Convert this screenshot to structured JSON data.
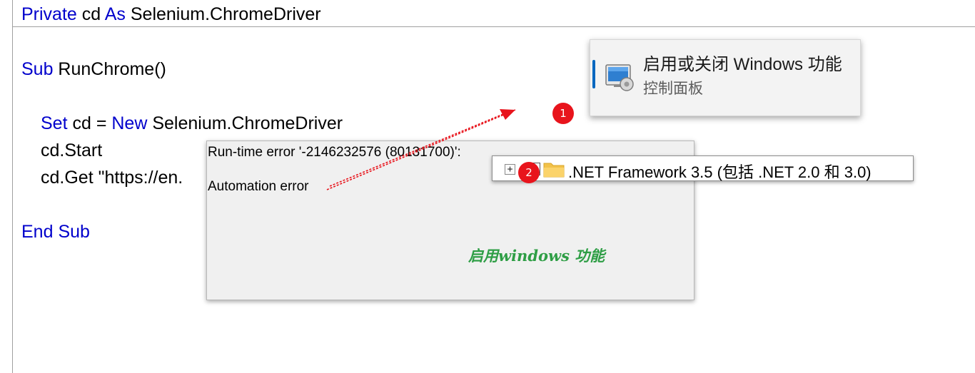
{
  "code": {
    "line1": {
      "kw1": "Private",
      "t1": " cd ",
      "kw2": "As",
      "t2": " Selenium.ChromeDriver"
    },
    "line2": {
      "kw1": "Sub",
      "t1": " RunChrome()"
    },
    "line3": {
      "kw1": "Set",
      "t1": " cd = ",
      "kw2": "New",
      "t2": " Selenium.ChromeDriver"
    },
    "line4": "cd.Start",
    "line5": "cd.Get \"https://en.",
    "line6": {
      "kw1": "End",
      "t1": " ",
      "kw2": "Sub"
    }
  },
  "search_result": {
    "title": "启用或关闭 Windows 功能",
    "subtitle": "控制面板",
    "icon": "control-panel-icon"
  },
  "badges": {
    "one": "1",
    "two": "2"
  },
  "error_dialog": {
    "message": "Run-time error '-2146232576 (80131700)':",
    "detail": "Automation error",
    "note": "启用windows 功能"
  },
  "feature_row": {
    "expand": "+",
    "label": ".NET Framework 3.5 (包括 .NET 2.0 和 3.0)",
    "icon": "folder-icon"
  },
  "colors": {
    "keyword": "#0000cc",
    "badge": "#e8141c",
    "arrow": "#e8141c",
    "note": "#2e9e45",
    "accent": "#0067c0"
  }
}
